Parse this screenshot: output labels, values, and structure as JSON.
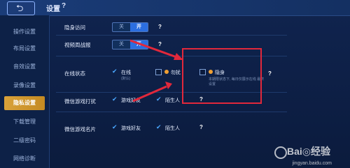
{
  "topbar": {
    "back_glyph": "⮌",
    "title": "设置",
    "help": "?"
  },
  "sidebar": {
    "items": [
      {
        "label": "操作设置"
      },
      {
        "label": "布局设置"
      },
      {
        "label": "音效设置"
      },
      {
        "label": "录像设置"
      },
      {
        "label": "隐私设置",
        "active": true
      },
      {
        "label": "下载管理"
      },
      {
        "label": "二级密码"
      },
      {
        "label": "网络诊断"
      }
    ]
  },
  "settings": {
    "invisible_visit": {
      "label": "隐身访问",
      "off": "关",
      "on": "开",
      "help": "?"
    },
    "video_report": {
      "label": "视频周战报",
      "off": "关",
      "on": "开",
      "help": "?"
    },
    "online_status": {
      "label": "在线状态",
      "option_online": "在线",
      "option_online_sub": "(默认)",
      "option_busy": "勿扰",
      "option_invisible": "隐身",
      "option_invisible_sub": "本期限状态下, 每日仅展示在线 最终设置",
      "help": "?"
    },
    "wechat_game_push": {
      "label": "微信游戏打扰",
      "friends": "游戏好友",
      "strangers": "陌生人",
      "help": "?"
    },
    "wechat_game_card": {
      "label": "微信游戏名片",
      "friends": "游戏好友",
      "strangers": "陌生人",
      "help": "?"
    }
  },
  "watermark": {
    "brand": "Bai◎经验",
    "url": "jingyan.baidu.com"
  },
  "colors": {
    "accent": "#2b6ee0",
    "active_tab": "#d9a23a",
    "annotation": "#e2283b"
  }
}
